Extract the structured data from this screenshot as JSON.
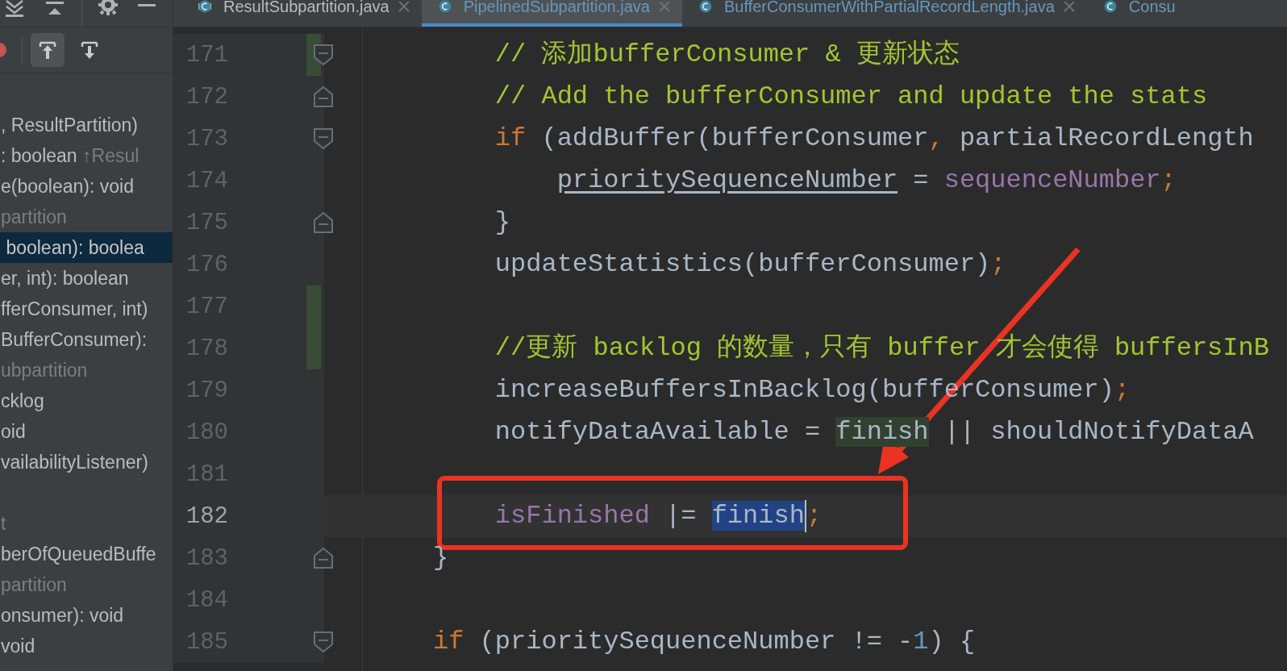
{
  "structure": {
    "toggles": [
      {
        "kind": "up",
        "on": true
      },
      {
        "kind": "down",
        "on": false
      }
    ],
    "items": [
      {
        "text": ", ResultPartition)",
        "kind": "member",
        "selected": false
      },
      {
        "text": ": boolean",
        "suffix": "↑Resul",
        "kind": "member",
        "selected": false
      },
      {
        "text": "e(boolean): void",
        "kind": "member",
        "selected": false
      },
      {
        "text": "partition",
        "kind": "group",
        "selected": false
      },
      {
        "text": " boolean): boolea",
        "kind": "member",
        "selected": true
      },
      {
        "text": "er, int): boolean",
        "kind": "member",
        "selected": false
      },
      {
        "text": "fferConsumer, int)",
        "kind": "member",
        "selected": false
      },
      {
        "text": "BufferConsumer):",
        "kind": "member",
        "selected": false
      },
      {
        "text": "ubpartition",
        "kind": "group",
        "selected": false
      },
      {
        "text": "cklog",
        "kind": "member",
        "selected": false
      },
      {
        "text": "oid",
        "kind": "member",
        "selected": false
      },
      {
        "text": "vailabilityListener)",
        "kind": "member",
        "selected": false
      },
      {
        "kind": "blank"
      },
      {
        "text": "t",
        "kind": "group",
        "selected": false
      },
      {
        "text": "berOfQueuedBuffe",
        "kind": "member",
        "selected": false
      },
      {
        "text": "partition",
        "kind": "group",
        "selected": false
      },
      {
        "text": "onsumer): void",
        "kind": "member",
        "selected": false
      },
      {
        "text": "void",
        "kind": "member",
        "selected": false
      }
    ]
  },
  "tabs": [
    {
      "label": "ResultSubpartition.java",
      "kind": "abstract-class",
      "selected": false,
      "modified": false,
      "closable": true
    },
    {
      "label": "PipelinedSubpartition.java",
      "kind": "class",
      "selected": true,
      "modified": true,
      "closable": true
    },
    {
      "label": "BufferConsumerWithPartialRecordLength.java",
      "kind": "class",
      "selected": false,
      "modified": true,
      "closable": true
    },
    {
      "label": "Consu",
      "kind": "class",
      "selected": false,
      "modified": true,
      "closable": false
    }
  ],
  "lines": [
    {
      "number": "171",
      "current": false,
      "changed": true,
      "fold_start": true,
      "fold_end": false,
      "caret": false,
      "tokens": [
        {
          "text": "    // 添加bufferConsumer & 更新状态",
          "kind": "comment"
        }
      ]
    },
    {
      "number": "172",
      "current": false,
      "changed": false,
      "fold_start": false,
      "fold_end": true,
      "caret": false,
      "tokens": [
        {
          "text": "    // Add the bufferConsumer and update the stats",
          "kind": "comment"
        }
      ]
    },
    {
      "number": "173",
      "current": false,
      "changed": false,
      "fold_start": true,
      "fold_end": false,
      "caret": false,
      "tokens": [
        {
          "text": "    if",
          "kind": "keyword"
        },
        {
          "text": " (addBuffer(bufferConsumer",
          "kind": "plain"
        },
        {
          "text": ",",
          "kind": "keyword"
        },
        {
          "text": " partialRecordLength",
          "kind": "plain"
        }
      ]
    },
    {
      "number": "174",
      "current": false,
      "changed": false,
      "fold_start": false,
      "fold_end": false,
      "caret": false,
      "tokens": [
        {
          "text": "        prioritySequenceNumber",
          "kind": "underlined"
        },
        {
          "text": " = ",
          "kind": "plain"
        },
        {
          "text": "sequenceNumber",
          "kind": "field"
        },
        {
          "text": ";",
          "kind": "keyword"
        }
      ]
    },
    {
      "number": "175",
      "current": false,
      "changed": false,
      "fold_start": false,
      "fold_end": true,
      "caret": false,
      "tokens": [
        {
          "text": "    }",
          "kind": "plain"
        }
      ]
    },
    {
      "number": "176",
      "current": false,
      "changed": false,
      "fold_start": false,
      "fold_end": false,
      "caret": false,
      "tokens": [
        {
          "text": "    updateStatistics(bufferConsumer)",
          "kind": "plain"
        },
        {
          "text": ";",
          "kind": "keyword"
        }
      ]
    },
    {
      "number": "177",
      "current": false,
      "changed": true,
      "fold_start": false,
      "fold_end": false,
      "caret": false
    },
    {
      "number": "178",
      "current": false,
      "changed": true,
      "fold_start": false,
      "fold_end": false,
      "caret": false,
      "tokens": [
        {
          "text": "    //更新 backlog 的数量，只有 buffer 才会使得 buffersInB",
          "kind": "comment"
        }
      ]
    },
    {
      "number": "179",
      "current": false,
      "changed": false,
      "fold_start": false,
      "fold_end": false,
      "caret": false,
      "tokens": [
        {
          "text": "    increaseBuffersInBacklog(bufferConsumer)",
          "kind": "plain"
        },
        {
          "text": ";",
          "kind": "keyword"
        }
      ]
    },
    {
      "number": "180",
      "current": false,
      "changed": false,
      "fold_start": false,
      "fold_end": false,
      "caret": false,
      "tokens": [
        {
          "text": "    notifyDataAvailable = ",
          "kind": "plain"
        },
        {
          "text": "finish",
          "kind": "usage"
        },
        {
          "text": " || shouldNotifyDataA",
          "kind": "plain"
        }
      ]
    },
    {
      "number": "181",
      "current": false,
      "changed": false,
      "fold_start": false,
      "fold_end": false,
      "caret": false
    },
    {
      "number": "182",
      "current": true,
      "changed": false,
      "fold_start": false,
      "fold_end": false,
      "caret": true,
      "tokens": [
        {
          "text": "    isFinished",
          "kind": "field"
        },
        {
          "text": " |= ",
          "kind": "plain"
        },
        {
          "text": "finish",
          "kind": "selection"
        },
        {
          "text": ";",
          "kind": "keyword"
        }
      ]
    },
    {
      "number": "183",
      "current": false,
      "changed": false,
      "fold_start": false,
      "fold_end": true,
      "caret": false,
      "tokens": [
        {
          "text": "}",
          "kind": "plain"
        }
      ]
    },
    {
      "number": "184",
      "current": false,
      "changed": false,
      "fold_start": false,
      "fold_end": false,
      "caret": false
    },
    {
      "number": "185",
      "current": false,
      "changed": false,
      "fold_start": true,
      "fold_end": false,
      "caret": false,
      "tokens": [
        {
          "text": "if",
          "kind": "keyword"
        },
        {
          "text": " (prioritySequenceNumber != -",
          "kind": "plain"
        },
        {
          "text": "1",
          "kind": "number"
        },
        {
          "text": ") {",
          "kind": "plain"
        }
      ]
    }
  ]
}
